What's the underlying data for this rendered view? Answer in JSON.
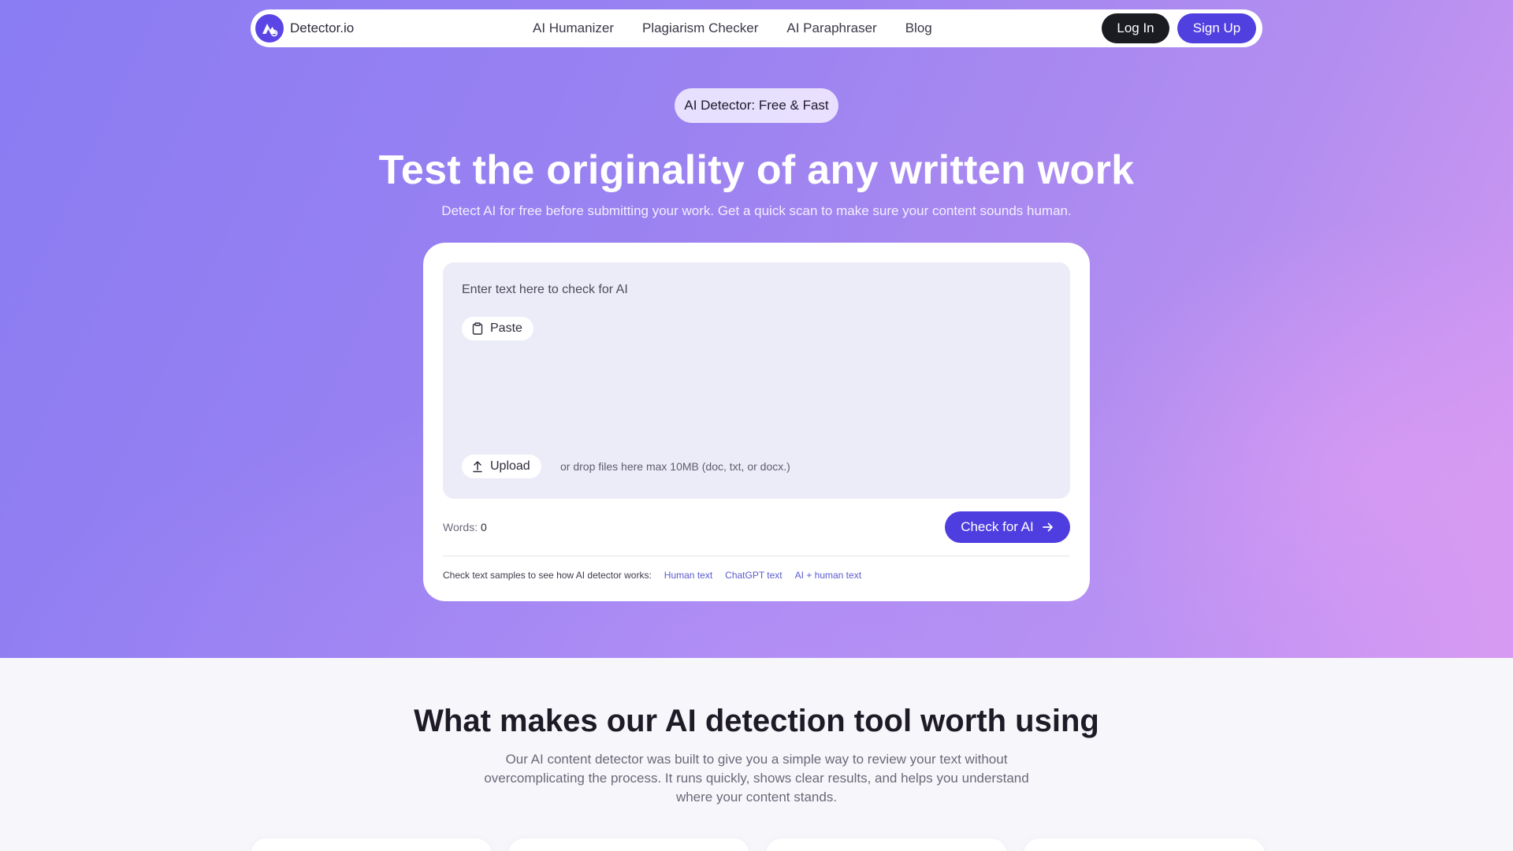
{
  "nav": {
    "brand": "Detector.io",
    "links": [
      "AI Humanizer",
      "Plagiarism Checker",
      "AI Paraphraser",
      "Blog"
    ],
    "login": "Log In",
    "signup": "Sign Up"
  },
  "hero": {
    "badge": "AI Detector: Free & Fast",
    "title": "Test the originality of any written work",
    "subtitle": "Detect AI for free before submitting your work. Get a quick scan to make sure your content sounds human."
  },
  "editor": {
    "placeholder": "Enter text here to check for AI",
    "paste_label": "Paste",
    "upload_label": "Upload",
    "drop_hint": "or drop files here max 10MB (doc, txt, or docx.)",
    "words_label": "Words:",
    "words_count": "0",
    "check_button": "Check for AI",
    "samples_label": "Check text samples to see how AI detector works:",
    "samples": [
      "Human text",
      "ChatGPT text",
      "AI + human text"
    ]
  },
  "features": {
    "title": "What makes our AI detection tool worth using",
    "body": "Our AI content detector was built to give you a simple way to review your text without overcomplicating the process. It runs quickly, shows clear results, and helps you understand where your content stands."
  },
  "colors": {
    "accent": "#5140e0",
    "dark_button": "#1b1b22",
    "hero_gradient_start": "#8a7cf3",
    "hero_gradient_end": "#d79af2"
  },
  "icons": {
    "brand": "detector-logo-icon",
    "paste": "clipboard-icon",
    "upload": "upload-arrow-icon",
    "check": "arrow-right-icon"
  }
}
